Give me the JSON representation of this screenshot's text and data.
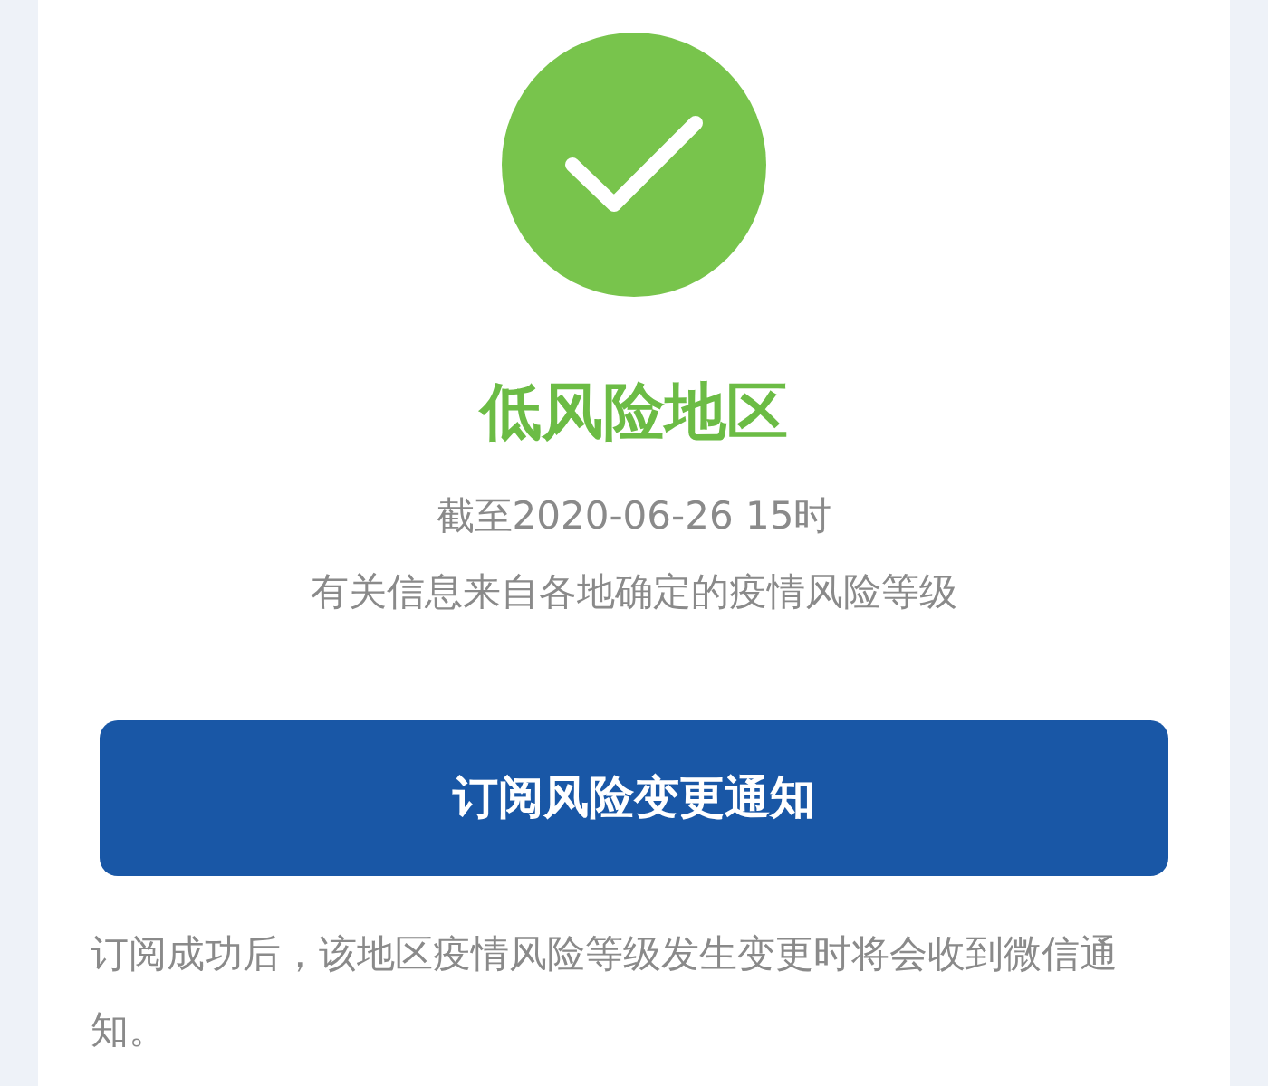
{
  "status": {
    "kind": "low",
    "title": "低风险地区",
    "as_of": "截至2020-06-26 15时",
    "source": "有关信息来自各地确定的疫情风险等级"
  },
  "subscribe_button": "订阅风险变更通知",
  "note": "订阅成功后，该地区疫情风险等级发生变更时将会收到微信通知。"
}
